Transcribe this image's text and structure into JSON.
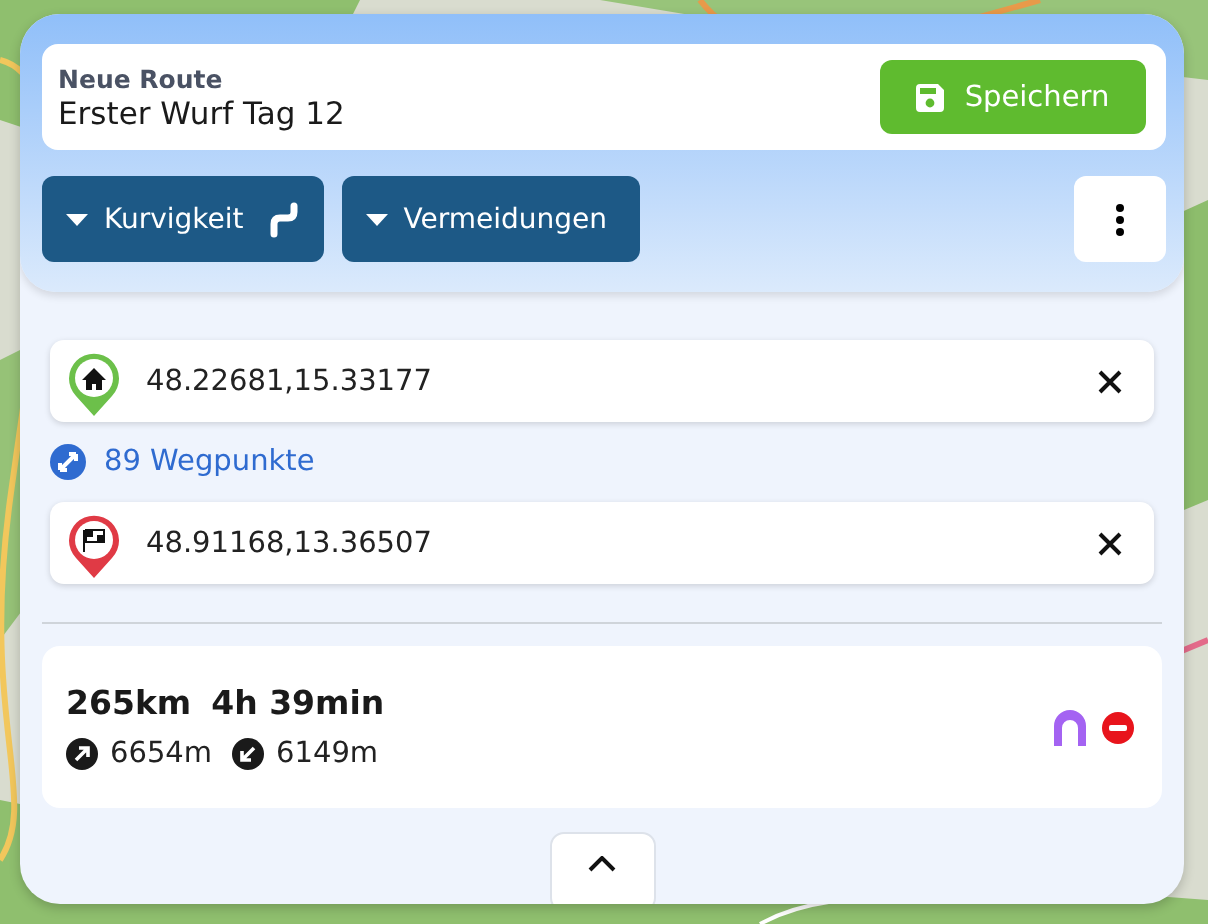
{
  "route": {
    "label": "Neue Route",
    "name": "Erster Wurf Tag 12",
    "save_button": "Speichern"
  },
  "options": [
    {
      "label": "Kurvigkeit",
      "kind": "curviness"
    },
    {
      "label": "Vermeidungen",
      "kind": "avoid"
    }
  ],
  "waypoints": [
    {
      "kind": "start",
      "value": "48.22681,15.33177",
      "color": "#6cc04a"
    },
    {
      "kind": "end",
      "value": "48.91168,13.36507",
      "color": "#e03a45"
    }
  ],
  "via": {
    "label": "89 Wegpunkte"
  },
  "summary": {
    "distance": "265km",
    "duration": "4h 39min",
    "ascent": "6654m",
    "descent": "6149m",
    "flags": [
      {
        "kind": "tunnel",
        "color": "#a463f2"
      },
      {
        "kind": "no_entry",
        "color": "#e8141c"
      }
    ]
  }
}
